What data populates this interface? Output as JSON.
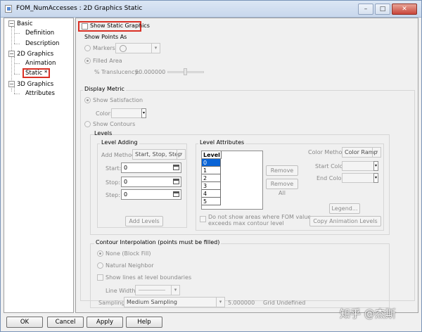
{
  "window": {
    "title": "FOM_NumAccesses : 2D Graphics Static",
    "controls": {
      "minimize": "–",
      "maximize": "□",
      "close": "✕"
    }
  },
  "tree": {
    "items": [
      {
        "label": "Basic",
        "expander": "−",
        "level": 0
      },
      {
        "label": "Definition",
        "level": 1
      },
      {
        "label": "Description",
        "level": 1
      },
      {
        "label": "2D Graphics",
        "expander": "−",
        "level": 0
      },
      {
        "label": "Animation",
        "level": 1
      },
      {
        "label": "Static *",
        "level": 1,
        "selected": true
      },
      {
        "label": "3D Graphics",
        "expander": "−",
        "level": 0
      },
      {
        "label": "Attributes",
        "level": 1
      }
    ]
  },
  "static": {
    "show_static_graphics": "Show Static Graphics",
    "show_points_as": "Show Points As",
    "markers": "Markers",
    "filled_area": "Filled Area",
    "translucency_label": "% Translucency:",
    "translucency_value": "50.000000",
    "translucency_fraction": 0.5,
    "display_metric": "Display Metric",
    "show_satisfaction": "Show Satisfaction",
    "color_label": "Color:",
    "show_contours": "Show Contours",
    "levels": "Levels",
    "level_adding": "Level Adding",
    "add_method_label": "Add Method:",
    "add_method_value": "Start, Stop, Step",
    "start_label": "Start:",
    "start_value": "0",
    "stop_label": "Stop:",
    "stop_value": "0",
    "step_label": "Step:",
    "step_value": "0",
    "add_levels": "Add Levels",
    "level_attributes": "Level Attributes",
    "level_list": {
      "header": "Level",
      "rows": [
        "0",
        "1",
        "2",
        "3",
        "4",
        "5"
      ]
    },
    "remove": "Remove",
    "remove_all": "Remove All",
    "color_method_label": "Color Method:",
    "color_method_value": "Color Ramp",
    "start_color_label": "Start Color:",
    "end_color_label": "End Color:",
    "legend": "Legend...",
    "do_not_show_line1": "Do not show areas where FOM value",
    "do_not_show_line2": "exceeds max contour level",
    "copy_animation_levels": "Copy Animation Levels",
    "contour_interp": "Contour Interpolation (points must be filled)",
    "none_block_fill": "None (Block Fill)",
    "natural_neighbor": "Natural Neighbor",
    "show_lines_at_boundaries": "Show lines at level boundaries",
    "line_width_label": "Line Width:",
    "sampling_label": "Sampling:",
    "sampling_value": "Medium Sampling",
    "sampling_number": "5.000000",
    "grid_undefined": "Grid Undefined"
  },
  "buttons": {
    "ok": "OK",
    "cancel": "Cancel",
    "apply": "Apply",
    "help": "Help"
  },
  "watermark": "知乎 @杰斯"
}
